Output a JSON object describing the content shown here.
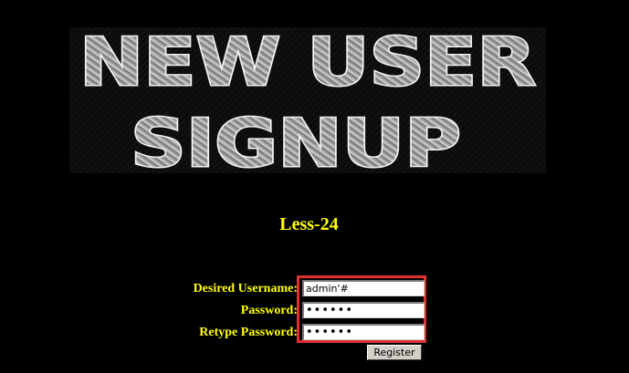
{
  "banner": {
    "line1": "NEW USER",
    "line2": "SIGNUP"
  },
  "lesson": {
    "title": "Less-24"
  },
  "form": {
    "username_label": "Desired Username:",
    "password_label": "Password:",
    "retype_label": "Retype Password:",
    "username_value": "admin'#",
    "password_value": "••••••",
    "retype_value": "••••••",
    "register_label": "Register"
  },
  "colors": {
    "background": "#000000",
    "label_text": "#ffff00",
    "highlight_border": "#e03131"
  }
}
